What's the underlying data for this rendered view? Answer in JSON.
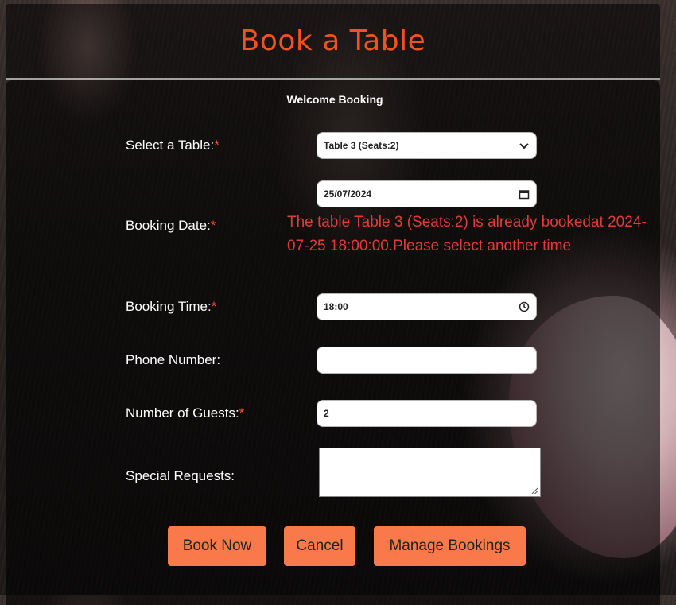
{
  "header": {
    "title": "Book a Table"
  },
  "form": {
    "title": "Welcome Booking",
    "required_marker": "*",
    "table": {
      "label": "Select a Table:",
      "value": "Table 3 (Seats:2)"
    },
    "date": {
      "label": "Booking Date:",
      "value": "25/07/2024",
      "error": "The table Table 3 (Seats:2) is already bookedat 2024-07-25 18:00:00.Please select another time"
    },
    "time": {
      "label": "Booking Time:",
      "value": "18:00"
    },
    "phone": {
      "label": "Phone Number:",
      "value": ""
    },
    "guests": {
      "label": "Number of Guests:",
      "value": "2"
    },
    "requests": {
      "label": "Special Requests:",
      "value": ""
    }
  },
  "buttons": {
    "book_now": "Book Now",
    "cancel": "Cancel",
    "manage": "Manage Bookings"
  },
  "colors": {
    "title_orange": "#f0531f",
    "button_orange": "#f9794b",
    "error_red": "#e23a3a",
    "required_red": "#ff4d2e"
  },
  "icons": [
    "chevron-down-icon",
    "calendar-icon",
    "clock-icon",
    "resize-grip-icon"
  ]
}
